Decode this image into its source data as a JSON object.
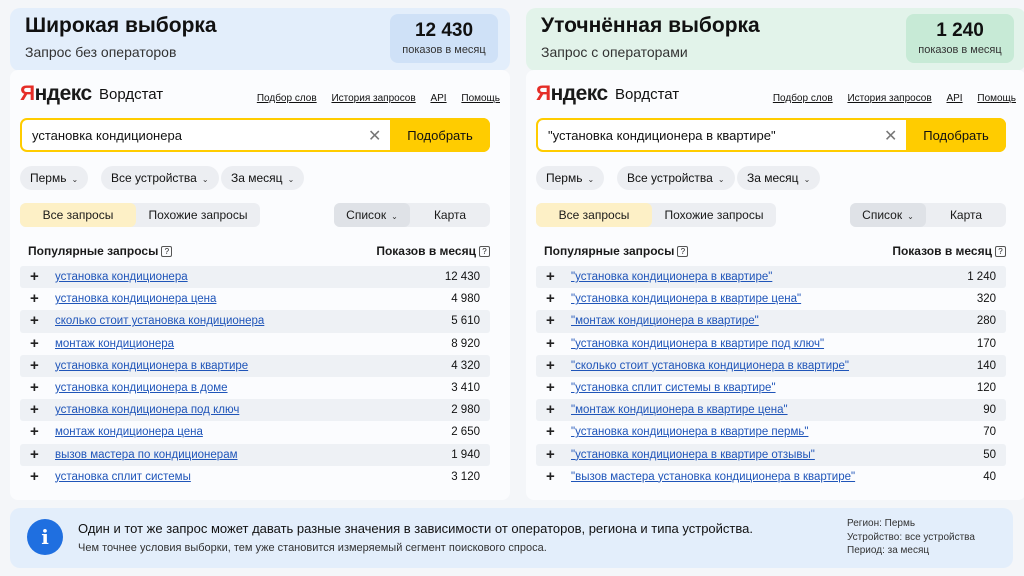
{
  "left": {
    "title": "Широкая выборка",
    "subtitle": "Запрос без операторов",
    "count": "12 430",
    "count_unit": "показов в месяц",
    "query": "установка кондиционера",
    "rows": [
      {
        "q": "установка кондиционера",
        "n": "12 430"
      },
      {
        "q": "установка кондиционера цена",
        "n": "4 980"
      },
      {
        "q": "сколько стоит установка кондиционера",
        "n": "5 610"
      },
      {
        "q": "монтаж кондиционера",
        "n": "8 920"
      },
      {
        "q": "установка кондиционера в квартире",
        "n": "4 320"
      },
      {
        "q": "установка кондиционера в доме",
        "n": "3 410"
      },
      {
        "q": "установка кондиционера под ключ",
        "n": "2 980"
      },
      {
        "q": "монтаж кондиционера цена",
        "n": "2 650"
      },
      {
        "q": "вызов мастера по кондиционерам",
        "n": "1 940"
      },
      {
        "q": "установка сплит системы",
        "n": "3 120"
      }
    ]
  },
  "right": {
    "title": "Уточнённая выборка",
    "subtitle": "Запрос с операторами",
    "count": "1 240",
    "count_unit": "показов в месяц",
    "query": "\"установка кондиционера в квартире\"",
    "rows": [
      {
        "q": "\"установка кондиционера в квартире\"",
        "n": "1 240"
      },
      {
        "q": "\"установка кондиционера в квартире цена\"",
        "n": "320"
      },
      {
        "q": "\"монтаж кондиционера в квартире\"",
        "n": "280"
      },
      {
        "q": "\"установка кондиционера в квартире под ключ\"",
        "n": "170"
      },
      {
        "q": "\"сколько стоит установка кондиционера в квартире\"",
        "n": "140"
      },
      {
        "q": "\"установка сплит системы в квартире\"",
        "n": "120"
      },
      {
        "q": "\"монтаж кондиционера в квартире цена\"",
        "n": "90"
      },
      {
        "q": "\"установка кондиционера в квартире пермь\"",
        "n": "70"
      },
      {
        "q": "\"установка кондиционера в квартире отзывы\"",
        "n": "50"
      },
      {
        "q": "\"вызов мастера установка кондиционера в квартире\"",
        "n": "40"
      }
    ]
  },
  "ui": {
    "logo_ya": "Я",
    "logo_rest": "ндекс",
    "wordstat": "Вордстат",
    "nav": [
      "Подбор слов",
      "История запросов",
      "API",
      "Помощь"
    ],
    "clear_glyph": "✕",
    "search_button": "Подобрать",
    "filters": [
      "Пермь",
      "Все устройства",
      "За месяц"
    ],
    "chevron": "⌄",
    "tabs": [
      "Все запросы",
      "Похожие запросы"
    ],
    "views": [
      "Список",
      "Карта"
    ],
    "col_queries": "Популярные запросы",
    "col_count": "Показов в месяц",
    "help_glyph": "?",
    "plus_glyph": "+"
  },
  "info": {
    "icon_glyph": "i",
    "main": "Один и тот же запрос может давать разные значения в зависимости от операторов, региона и типа устройства.",
    "sub": "Чем точнее условия выборки, тем уже становится измеряемый сегмент поискового спроса.",
    "region": "Регион: Пермь",
    "device": "Устройство: все устройства",
    "period": "Период: за месяц"
  },
  "colors": {
    "accent_yellow": "#ffcc00",
    "link_blue": "#1f55b9",
    "logo_red": "#e52d27",
    "info_blue": "#1f6fe0"
  }
}
